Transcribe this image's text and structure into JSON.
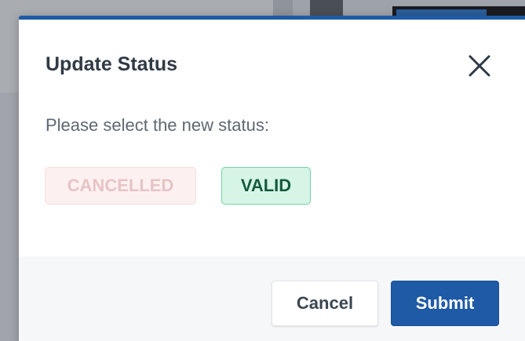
{
  "dialog": {
    "title": "Update Status",
    "prompt": "Please select the new status:",
    "options": [
      {
        "label": "CANCELLED",
        "state": "disabled"
      },
      {
        "label": "VALID",
        "state": "selected"
      }
    ],
    "buttons": {
      "cancel_label": "Cancel",
      "submit_label": "Submit"
    }
  },
  "colors": {
    "accent": "#1f5aa6",
    "valid_bg": "#d6f5e6",
    "valid_border": "#6fd3a6",
    "valid_text": "#145a3e",
    "cancelled_bg": "#fdf0f0",
    "cancelled_text": "#e6c4c5"
  },
  "icons": {
    "close": "close-icon"
  }
}
